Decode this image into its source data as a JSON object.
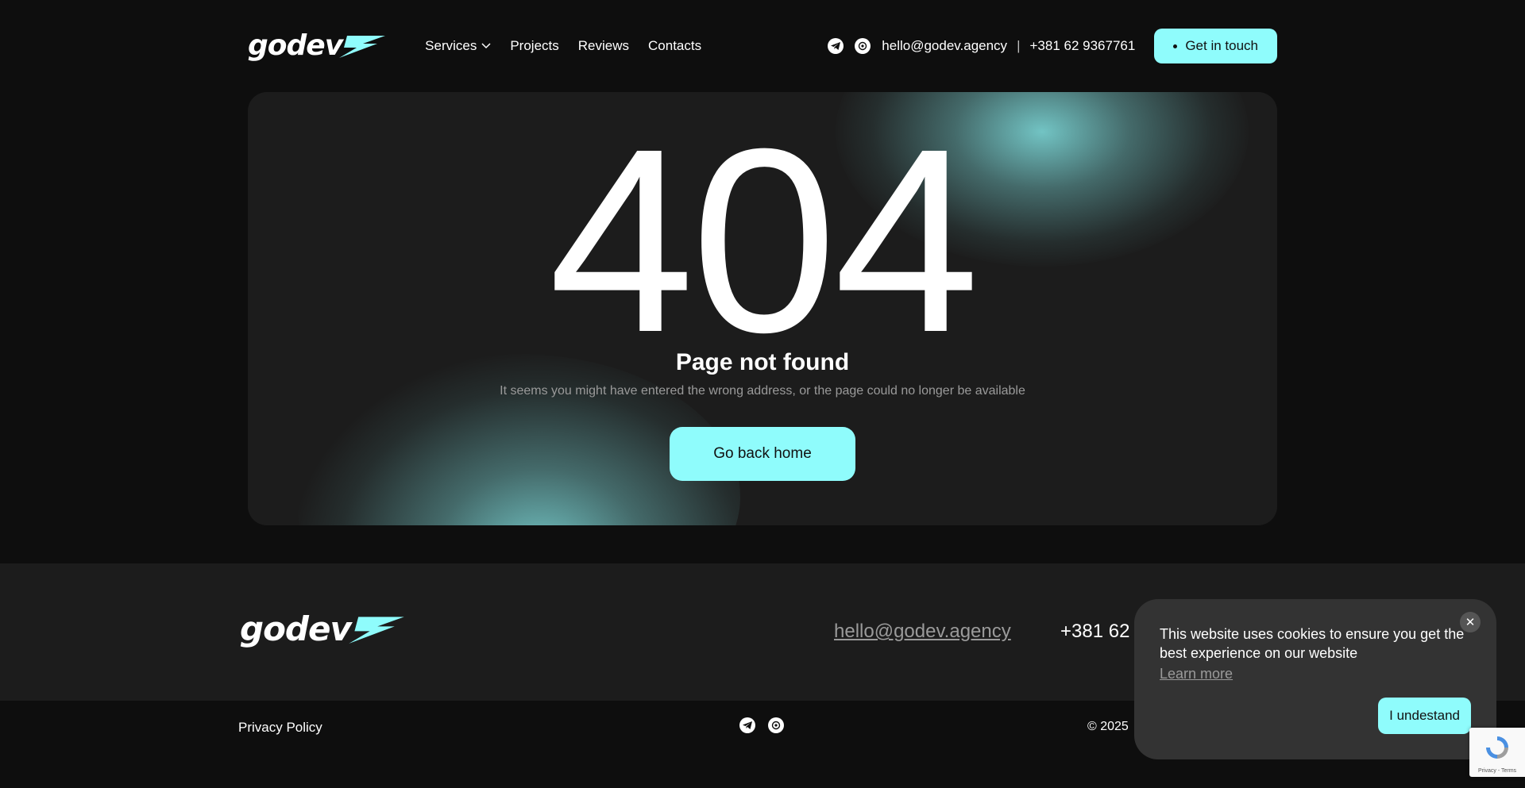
{
  "header": {
    "logo_text": "godev",
    "nav": [
      {
        "label": "Services",
        "has_dropdown": true
      },
      {
        "label": "Projects"
      },
      {
        "label": "Reviews"
      },
      {
        "label": "Contacts"
      }
    ],
    "social_icons": [
      "telegram-icon",
      "whatsapp-icon"
    ],
    "email": "hello@godev.agency",
    "separator": "|",
    "phone": "+381 62 9367761",
    "cta_label": "Get in touch"
  },
  "hero": {
    "code": "404",
    "title": "Page not found",
    "subtitle": "It seems you might have entered the wrong address, or the page could no longer be available",
    "button_label": "Go back home"
  },
  "footer": {
    "logo_text": "godev",
    "email": "hello@godev.agency",
    "phone_visible": "+381 62 9",
    "privacy_label": "Privacy Policy",
    "social_icons": [
      "telegram-icon",
      "whatsapp-icon"
    ],
    "copyright_visible": "© 2025"
  },
  "cookie_banner": {
    "text": "This website uses cookies to ensure you get the best experience on our website",
    "learn_more": "Learn more",
    "close_glyph": "✕",
    "accept_label": "I undestand"
  },
  "recaptcha": {
    "links": "Privacy - Terms"
  },
  "colors": {
    "page_bg": "#0e0e0e",
    "card_bg": "#1c1c1c",
    "accent": "#8ffcfc",
    "muted_text": "#9a9a9a",
    "cookie_bg": "#333333"
  }
}
